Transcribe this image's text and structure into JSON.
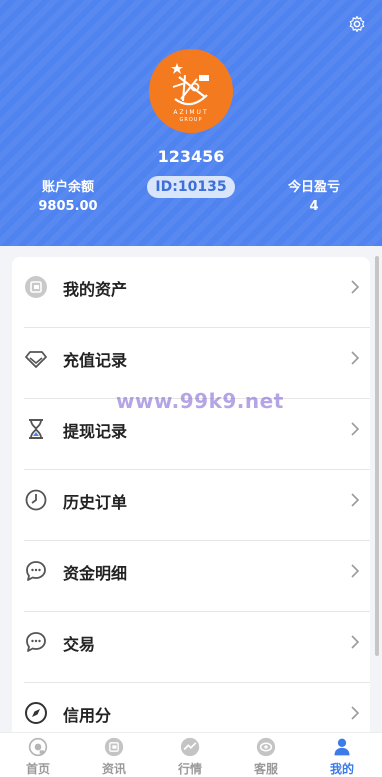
{
  "profile": {
    "logo_brand": "AZIMUT",
    "logo_sub": "GROUP",
    "username": "123456",
    "balance_label": "账户余额",
    "balance_value": "9805.00",
    "id_badge": "ID:10135",
    "pnl_label": "今日盈亏",
    "pnl_value": "4"
  },
  "menu": {
    "items": [
      {
        "label": "我的资产",
        "icon": "wallet-icon"
      },
      {
        "label": "充值记录",
        "icon": "diamond-icon"
      },
      {
        "label": "提现记录",
        "icon": "hourglass-icon"
      },
      {
        "label": "历史订单",
        "icon": "clock-icon"
      },
      {
        "label": "资金明细",
        "icon": "chat-bubble-icon"
      },
      {
        "label": "交易",
        "icon": "chat-bubble-icon"
      },
      {
        "label": "信用分",
        "icon": "compass-icon"
      }
    ]
  },
  "watermark": "www.99k9.net",
  "tabbar": {
    "tabs": [
      {
        "label": "首页",
        "icon": "home-icon",
        "active": false
      },
      {
        "label": "资讯",
        "icon": "news-icon",
        "active": false
      },
      {
        "label": "行情",
        "icon": "trend-icon",
        "active": false
      },
      {
        "label": "客服",
        "icon": "service-icon",
        "active": false
      },
      {
        "label": "我的",
        "icon": "user-icon",
        "active": true
      }
    ]
  },
  "colors": {
    "header_blue": "#4f83f0",
    "logo_orange": "#f47a20",
    "active_tab": "#3d7be8",
    "badge_bg": "#d9e5fb"
  }
}
